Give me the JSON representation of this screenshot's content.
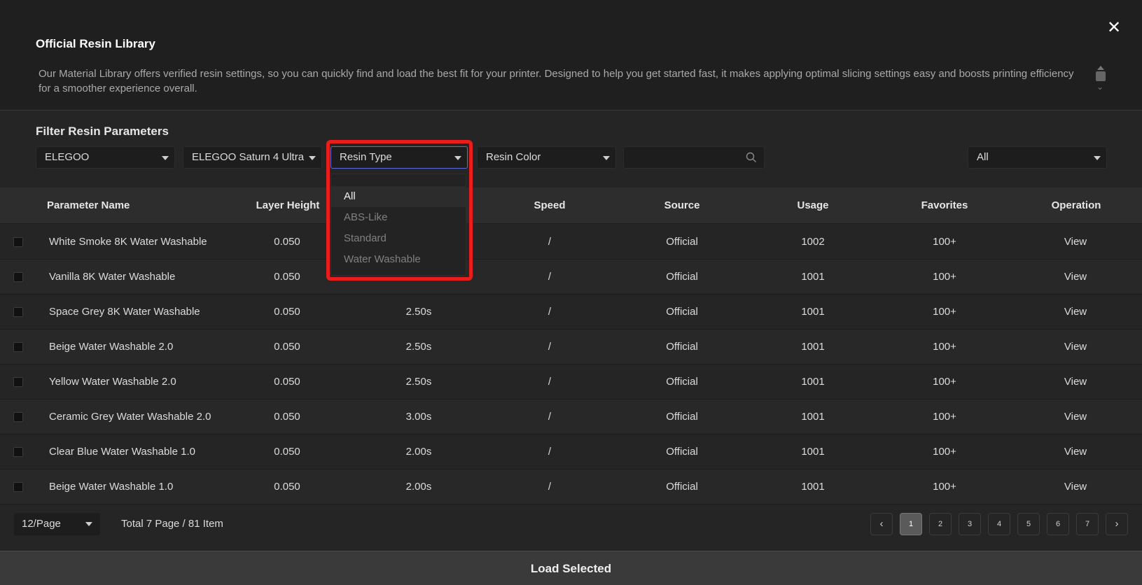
{
  "header": {
    "title": "Official Resin Library",
    "description": "Our Material Library offers verified resin settings, so you can quickly find and load the best fit for your printer. Designed to help you get started fast, it makes applying optimal slicing settings easy and boosts printing efficiency for a smoother experience overall.",
    "close_icon": "close-icon"
  },
  "filters": {
    "title": "Filter Resin Parameters",
    "brand": "ELEGOO",
    "printer": "ELEGOO Saturn 4 Ultra",
    "resin_type": "Resin Type",
    "resin_color": "Resin Color",
    "search_placeholder": "",
    "scope": "All"
  },
  "resin_type_dropdown": {
    "options": [
      "All",
      "ABS-Like",
      "Standard",
      "Water Washable"
    ],
    "selected": "All"
  },
  "table": {
    "columns": [
      "Parameter Name",
      "Layer Height",
      "",
      "Speed",
      "Source",
      "Usage",
      "Favorites",
      "Operation"
    ],
    "rows": [
      {
        "name": "White Smoke 8K Water Washable",
        "layer_height": "0.050",
        "exposure": "",
        "speed": "/",
        "source": "Official",
        "usage": "1002",
        "favorites": "100+",
        "operation": "View"
      },
      {
        "name": "Vanilla 8K Water Washable",
        "layer_height": "0.050",
        "exposure": "",
        "speed": "/",
        "source": "Official",
        "usage": "1001",
        "favorites": "100+",
        "operation": "View"
      },
      {
        "name": "Space Grey 8K Water Washable",
        "layer_height": "0.050",
        "exposure": "2.50s",
        "speed": "/",
        "source": "Official",
        "usage": "1001",
        "favorites": "100+",
        "operation": "View"
      },
      {
        "name": "Beige Water Washable 2.0",
        "layer_height": "0.050",
        "exposure": "2.50s",
        "speed": "/",
        "source": "Official",
        "usage": "1001",
        "favorites": "100+",
        "operation": "View"
      },
      {
        "name": "Yellow Water Washable 2.0",
        "layer_height": "0.050",
        "exposure": "2.50s",
        "speed": "/",
        "source": "Official",
        "usage": "1001",
        "favorites": "100+",
        "operation": "View"
      },
      {
        "name": "Ceramic Grey Water Washable 2.0",
        "layer_height": "0.050",
        "exposure": "3.00s",
        "speed": "/",
        "source": "Official",
        "usage": "1001",
        "favorites": "100+",
        "operation": "View"
      },
      {
        "name": "Clear Blue Water Washable 1.0",
        "layer_height": "0.050",
        "exposure": "2.00s",
        "speed": "/",
        "source": "Official",
        "usage": "1001",
        "favorites": "100+",
        "operation": "View"
      },
      {
        "name": "Beige Water Washable 1.0",
        "layer_height": "0.050",
        "exposure": "2.00s",
        "speed": "/",
        "source": "Official",
        "usage": "1001",
        "favorites": "100+",
        "operation": "View"
      }
    ]
  },
  "pagination": {
    "page_size": "12/Page",
    "total": "Total 7 Page / 81 Item",
    "pages": [
      "1",
      "2",
      "3",
      "4",
      "5",
      "6",
      "7"
    ],
    "current": "1",
    "prev_icon": "chevron-left-icon",
    "next_icon": "chevron-right-icon"
  },
  "footer": {
    "load_label": "Load Selected"
  },
  "colors": {
    "highlight": "#ea1d1d",
    "active_border": "#5e6dd6",
    "background": "#252525"
  }
}
